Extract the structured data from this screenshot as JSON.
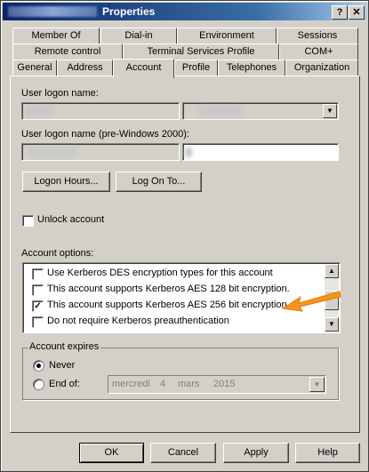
{
  "window": {
    "title": "Properties",
    "help_label": "?",
    "close_label": "✕"
  },
  "tabs": {
    "row1": [
      "Member Of",
      "Dial-in",
      "Environment",
      "Sessions"
    ],
    "row2": [
      "Remote control",
      "Terminal Services Profile",
      "COM+"
    ],
    "row3": [
      "General",
      "Address",
      "Account",
      "Profile",
      "Telephones",
      "Organization"
    ]
  },
  "account": {
    "logon_name_label": "User logon name:",
    "logon_name_pre2000_label": "User logon name (pre-Windows 2000):",
    "logon_hours_button": "Logon Hours...",
    "log_on_to_button": "Log On To...",
    "unlock_label": "Unlock account",
    "options_label": "Account options:",
    "options": [
      {
        "label": "Use Kerberos DES encryption types for this account",
        "checked": false
      },
      {
        "label": "This account supports Kerberos AES 128 bit encryption.",
        "checked": false
      },
      {
        "label": "This account supports Kerberos AES 256 bit encryption.",
        "checked": true
      },
      {
        "label": "Do not require Kerberos preauthentication",
        "checked": false
      }
    ],
    "expires_label": "Account expires",
    "never_label": "Never",
    "end_of_label": "End of:",
    "date": {
      "weekday": "mercredi",
      "day": "4",
      "month": "mars",
      "year": "2015"
    }
  },
  "buttons": {
    "ok": "OK",
    "cancel": "Cancel",
    "apply": "Apply",
    "help": "Help"
  },
  "annotation": {
    "arrow_color": "#f7941d"
  }
}
